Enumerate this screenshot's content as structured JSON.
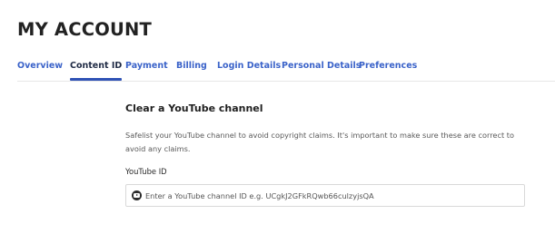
{
  "page": {
    "title": "MY ACCOUNT"
  },
  "tabs": [
    {
      "label": "Overview",
      "active": false
    },
    {
      "label": "Content ID",
      "active": true
    },
    {
      "label": "Payment",
      "active": false
    },
    {
      "label": "Billing",
      "active": false
    },
    {
      "label": "Login Details",
      "active": false
    },
    {
      "label": "Personal Details",
      "active": false
    },
    {
      "label": "Preferences",
      "active": false
    }
  ],
  "section": {
    "title": "Clear a YouTube channel",
    "description": "Safelist your YouTube channel to avoid copyright claims. It's important to make sure these are correct to avoid any claims."
  },
  "youtube_field": {
    "label": "YouTube ID",
    "value": "",
    "placeholder": "Enter a YouTube channel ID e.g. UCgkJ2GFkRQwb66culzyjsQA",
    "icon": "youtube-icon"
  },
  "colors": {
    "tab_link": "#3b63c9",
    "tab_active_text": "#1f2a44",
    "tab_active_underline": "#2f52b5",
    "heading": "#222222"
  }
}
